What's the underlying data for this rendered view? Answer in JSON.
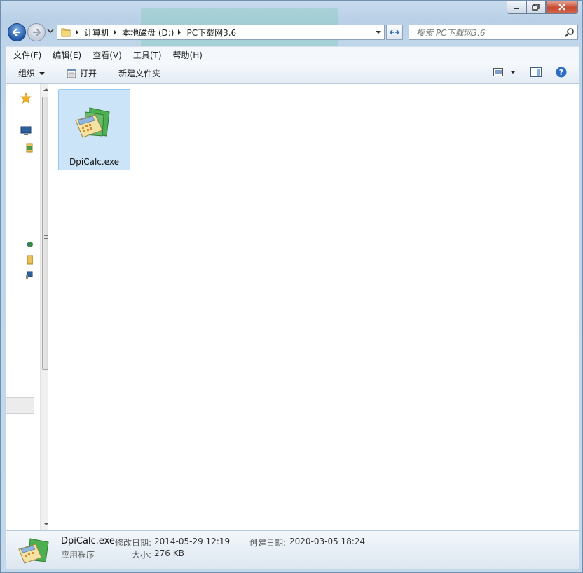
{
  "window": {
    "controls": {
      "minimize_icon": "minimize-icon",
      "maximize_icon": "maximize-icon",
      "close_icon": "close-icon"
    }
  },
  "nav": {
    "breadcrumb": [
      "计算机",
      "本地磁盘 (D:)",
      "PC下载网3.6"
    ],
    "search_placeholder": "搜索 PC下载网3.6"
  },
  "menu": [
    "文件(F)",
    "编辑(E)",
    "查看(V)",
    "工具(T)",
    "帮助(H)"
  ],
  "toolbar": {
    "organize": "组织",
    "open": "打开",
    "new_folder": "新建文件夹"
  },
  "files": [
    {
      "name": "DpiCalc.exe",
      "icon": "calculator-app-icon",
      "selected": true
    }
  ],
  "details": {
    "name": "DpiCalc.exe",
    "type": "应用程序",
    "modified_label": "修改日期:",
    "modified_value": "2014-05-29 12:19",
    "created_label": "创建日期:",
    "created_value": "2020-03-05 18:24",
    "size_label": "大小:",
    "size_value": "276 KB"
  },
  "colors": {
    "selection": "#cce4f7",
    "selection_border": "#99c8ee",
    "frame": "#c4d8eb"
  }
}
